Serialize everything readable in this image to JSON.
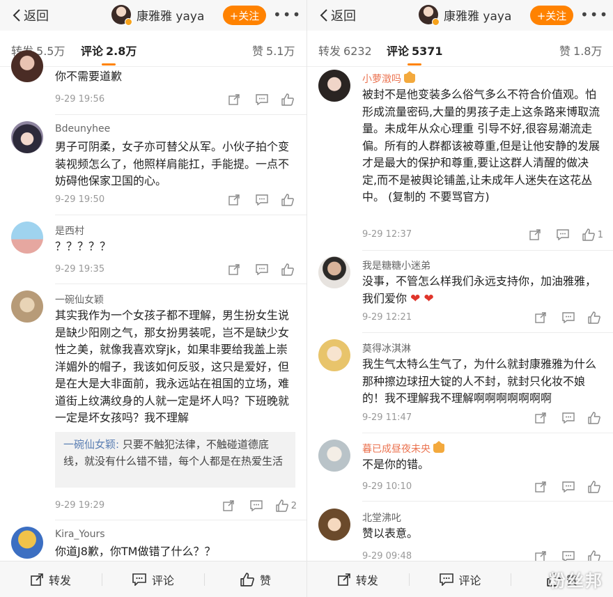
{
  "colors": {
    "accent": "#ff8200",
    "name_gray": "#666666",
    "name_orange": "#eb7350",
    "quote_name": "#5b7fb3"
  },
  "left": {
    "header": {
      "back_label": "返回",
      "account_name": "康雅雅 yaya",
      "follow_label": "+关注",
      "more_icon": "more-icon"
    },
    "tabs": [
      {
        "label": "转发",
        "count": "5.5万"
      },
      {
        "label": "评论",
        "count": "2.8万"
      },
      {
        "label": "赞",
        "count": "5.1万"
      }
    ],
    "comments": [
      {
        "name": "",
        "text": "你不需要道歉",
        "time": "9-29 19:56",
        "likes": ""
      },
      {
        "name": "Bdeunyhee",
        "text": "男子可阴柔，女子亦可替父从军。小伙子拍个变装视频怎么了，他照样肩能扛，手能提。一点不妨碍他保家卫国的心。",
        "time": "9-29 19:50",
        "likes": ""
      },
      {
        "name": "是西村",
        "text": "？？？？？",
        "time": "9-29 19:35",
        "likes": ""
      },
      {
        "name": "一碗仙女颖",
        "text": "其实我作为一个女孩子都不理解，男生扮女生说是缺少阳刚之气，那女扮男装呢，岂不是缺少女性之美，就像我喜欢穿jk，如果非要给我盖上崇洋媚外的帽子，我该如何反驳，这只是爱好，但是在大是大非面前，我永远站在祖国的立场，难道街上纹满纹身的人就一定是坏人吗？下班晚就一定是坏女孩吗？我不理解",
        "quote_name": "一碗仙女颖:",
        "quote_text": "只要不触犯法律，不触碰道德底线，就没有什么错不错，每个人都是在热爱生活",
        "time": "9-29 19:29",
        "likes": "2"
      },
      {
        "name": "Kira_Yours",
        "text": "你道J8歉，你TM做错了什么？？",
        "time": "",
        "likes": ""
      }
    ],
    "bottom": {
      "repost": "转发",
      "comment": "评论",
      "like": "赞"
    }
  },
  "right": {
    "header": {
      "back_label": "返回",
      "account_name": "康雅雅 yaya",
      "follow_label": "+关注",
      "more_icon": "more-icon"
    },
    "tabs": [
      {
        "label": "转发",
        "count": "6232"
      },
      {
        "label": "评论",
        "count": "5371"
      },
      {
        "label": "赞",
        "count": "1.8万"
      }
    ],
    "comments": [
      {
        "name": "小萝澂吗",
        "text": "被封不是他变装多么俗气多么不符合价值观。怕形成流量密码,大量的男孩子走上这条路来博取流量。未成年从众心理重 引导不好,很容易潮流走偏。所有的人群都该被尊重,但是让他安静的发展才是最大的保护和尊重,要让这群人清醒的做决定,而不是被舆论铺盖,让未成年人迷失在这花丛中。 (复制的 不要骂官方)",
        "time": "9-29 12:37",
        "likes": "1"
      },
      {
        "name": "我是糖糖小迷弟",
        "text": "没事，不管怎么样我们永远支持你，加油雅雅，我们爱你",
        "time": "9-29 12:21",
        "likes": ""
      },
      {
        "name": "莫得冰淇淋",
        "text": "我生气太特么生气了，为什么就封康雅雅为什么那种擦边球扭大锭的人不封，就封只化妆不娘的！我不理解我不理解啊啊啊啊啊啊啊",
        "time": "9-29 11:47",
        "likes": ""
      },
      {
        "name": "暮已成昼夜未央",
        "text": "不是你的错。",
        "time": "9-29 10:10",
        "likes": ""
      },
      {
        "name": "北堂沸叱",
        "text": "赞以表意。",
        "time": "9-29 09:48",
        "likes": ""
      }
    ],
    "bottom": {
      "repost": "转发",
      "comment": "评论",
      "like": "赞"
    }
  },
  "watermark": "粉丝邦"
}
